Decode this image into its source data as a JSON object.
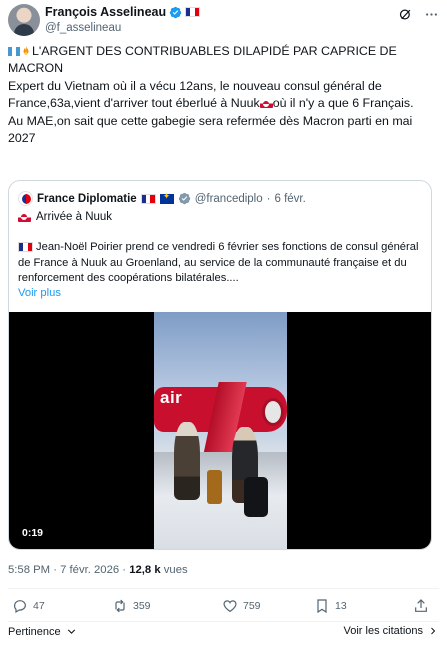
{
  "author": {
    "name": "François Asselineau",
    "handle": "@f_asselineau",
    "avatar_icon": "avatar",
    "flag": "france-flag-icon"
  },
  "tweet": {
    "lines": [
      "L'ARGENT DES CONTRIBUABLES DILAPIDÉ PAR CAPRICE DE MACRON",
      "Expert du Vietnam où il a vécu 12ans, le nouveau consul général de France,63a,vient d'arriver tout éberlué à Nuuk",
      "où il n'y a que 6 Français.",
      "Au MAE,on sait que cette gabegie sera refermée dès Macron parti en mai 2027"
    ]
  },
  "quote": {
    "name": "France Diplomatie",
    "handle": "@francediplo",
    "time": "6 févr.",
    "title": "Arrivée à Nuuk",
    "body": "Jean-Noël Poirier prend ce vendredi 6 février ses fonctions de consul général de France à Nuuk au Groenland, au service de la communauté française et du renforcement des coopérations bilatérales....",
    "more": "Voir plus",
    "video_time": "0:19",
    "plane_text": "air"
  },
  "meta": {
    "timestamp": "5:58 PM · 7 févr. 2026 · ",
    "views": "12,8 k",
    "views_label": " vues"
  },
  "actions": {
    "replies": "47",
    "reposts": "359",
    "likes": "759",
    "bookmarks": "13"
  },
  "footer": {
    "sort_label": "Pertinence",
    "view_quotes": "Voir les citations"
  },
  "colors": {
    "accent": "#1d9bf0",
    "text": "#0f1419",
    "muted": "#536471",
    "border": "#cfd9de"
  }
}
